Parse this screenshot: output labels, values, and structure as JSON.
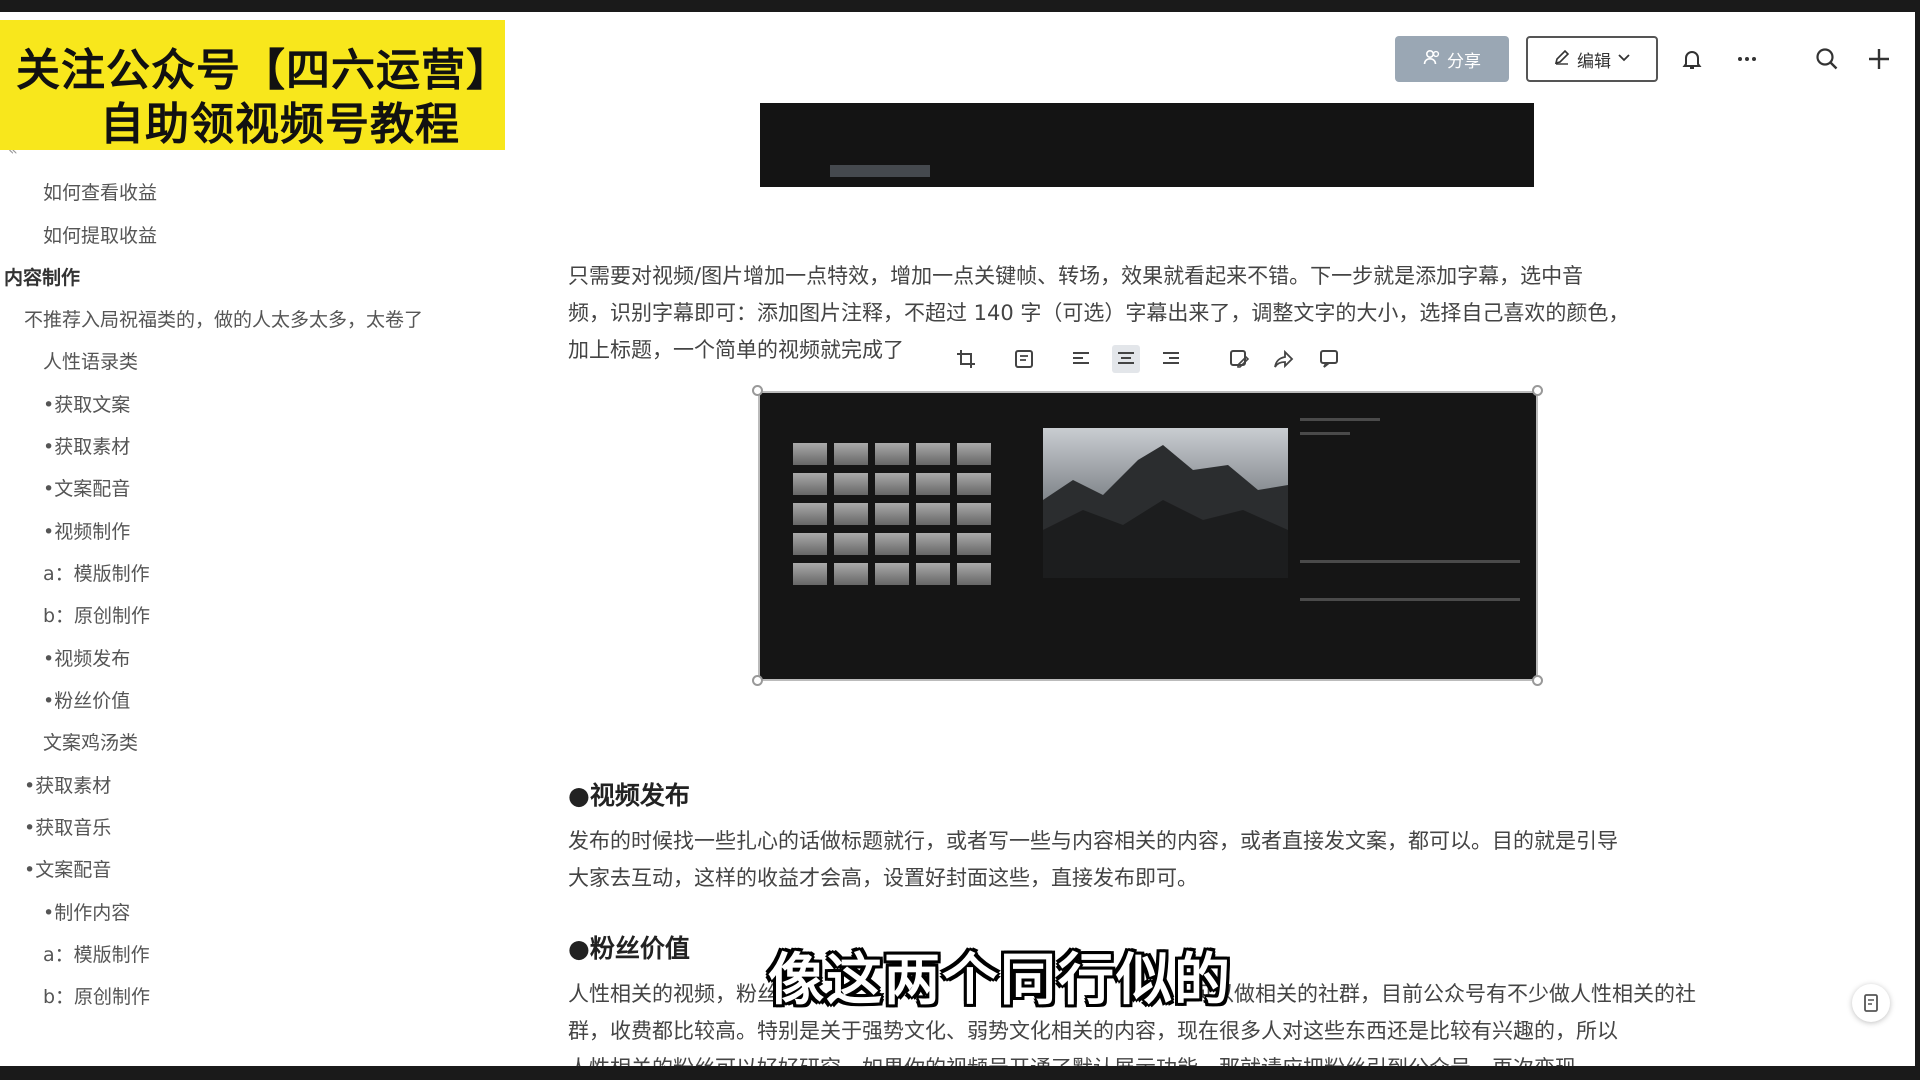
{
  "banner": {
    "line1": "关注公众号【四六运营】",
    "line2": "自助领视频号教程"
  },
  "sidebar": {
    "collapse_icon": "«",
    "items": [
      {
        "label": "如何查看收益"
      },
      {
        "label": "如何提取收益"
      },
      {
        "label": "内容制作"
      },
      {
        "label": "不推荐入局祝福类的，做的人太多太多，太卷了"
      },
      {
        "label": "人性语录类"
      },
      {
        "label": "•获取文案"
      },
      {
        "label": "•获取素材"
      },
      {
        "label": "•文案配音"
      },
      {
        "label": "•视频制作"
      },
      {
        "label": "a：模版制作"
      },
      {
        "label": "b：原创制作"
      },
      {
        "label": "•视频发布"
      },
      {
        "label": "•粉丝价值"
      },
      {
        "label": "文案鸡汤类"
      },
      {
        "label": "•获取素材"
      },
      {
        "label": "•获取音乐"
      },
      {
        "label": "•文案配音"
      },
      {
        "label": "•制作内容"
      },
      {
        "label": "a：模版制作"
      },
      {
        "label": "b：原创制作"
      }
    ]
  },
  "header": {
    "share_label": "分享",
    "edit_label": "编辑",
    "icons": [
      "user-icon",
      "pencil-icon",
      "chevron-down-icon",
      "bell-icon",
      "more-icon",
      "search-icon",
      "plus-icon"
    ]
  },
  "content": {
    "para1": [
      "只需要对视频/图片增加一点特效，增加一点关键帧、转场，效果就看起来不错。下一步就是添加字幕，选中音",
      "频，识别字幕即可：添加图片注释，不超过 140 字（可选）字幕出来了，调整文字的大小，选择自己喜欢的颜色，",
      "加上标题，一个简单的视频就完成了"
    ],
    "heading1": "●视频发布",
    "para2": [
      "发布的时候找一些扎心的话做标题就行，或者写一些与内容相关的内容，或者直接发文案，都可以。目的就是引导",
      "大家去互动，这样的收益才会高，设置好封面这些，直接发布即可。"
    ],
    "heading2": "●粉丝价值",
    "para3": [
      "人性相关的视频，粉丝",
      "群，收费都比较高。特别是关于强势文化、弱势文化相关的内容，现在很多人对这些东西还是比较有兴趣的，所以",
      "人性相关的粉丝可以好好研究，如果你的视频号开通了默认展示功能，那就请应把粉丝引到公众号，再次变现"
    ],
    "para3_tail": "可以做相关的社群，目前公众号有不少做人性相关的社"
  },
  "image_toolbar": {
    "icons": [
      "crop-icon",
      "note-icon",
      "align-left-icon",
      "align-center-icon",
      "align-right-icon",
      "edit-image-icon",
      "share-icon",
      "comment-icon"
    ]
  },
  "subtitle": "像这两个同行似的",
  "float_icon": "doc-icon"
}
